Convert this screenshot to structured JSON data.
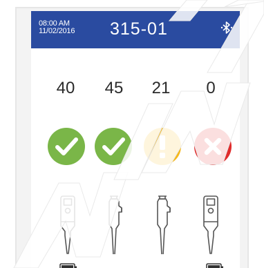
{
  "header": {
    "time": "08:00 AM",
    "date": "11/02/2016",
    "title": "315-01",
    "bluetooth_icon": "bluetooth-icon",
    "background_color": "#2a4ba0"
  },
  "channels": [
    {
      "count": "40",
      "status": "ok",
      "status_icon": "check-icon",
      "status_color": "#7ab648",
      "device": "electronic-pipette",
      "battery": true
    },
    {
      "count": "45",
      "status": "ok",
      "status_icon": "check-icon",
      "status_color": "#7ab648",
      "device": "manual-pipette",
      "battery": false
    },
    {
      "count": "21",
      "status": "warning",
      "status_icon": "exclamation-icon",
      "status_color": "#f5b81c",
      "device": "manual-pipette",
      "battery": false
    },
    {
      "count": "0",
      "status": "error",
      "status_icon": "x-icon",
      "status_color": "#e02b2b",
      "device": "electronic-pipette",
      "battery": true
    }
  ],
  "watermark": "MIMMIC"
}
